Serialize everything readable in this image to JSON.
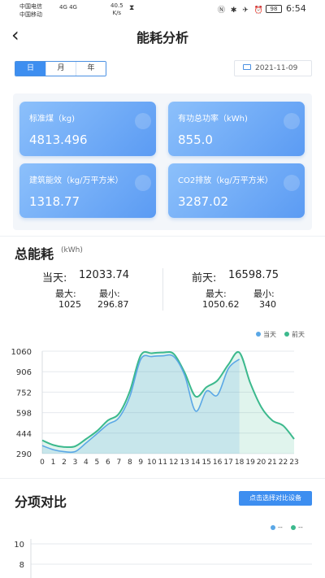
{
  "status_bar": {
    "carrier1": "中国电信",
    "carrier2": "中国移动",
    "net": "4G 4G",
    "speed_value": "40.5",
    "speed_unit": "K/s",
    "battery": "98",
    "time": "6:54"
  },
  "nav": {
    "back_icon": "chevron-left-icon",
    "title": "能耗分析"
  },
  "period_tabs": [
    {
      "label": "日",
      "active": true
    },
    {
      "label": "月",
      "active": false
    },
    {
      "label": "年",
      "active": false
    }
  ],
  "date_picker": {
    "icon": "calendar-icon",
    "value": "2021-11-09"
  },
  "cards": [
    {
      "label": "标准煤（kg)",
      "value": "4813.496"
    },
    {
      "label": "有功总功率（kWh)",
      "value": "855.0"
    },
    {
      "label": "建筑能效（kg/万平方米）",
      "value": "1318.77"
    },
    {
      "label": "CO2排放（kg/万平方米）",
      "value": "3287.02"
    }
  ],
  "total_energy": {
    "title": "总能耗",
    "unit": "(kWh)",
    "today": {
      "label": "当天:",
      "value": "12033.74",
      "max_label": "最大:",
      "min_label": "最小:",
      "max": "1025",
      "min": "296.87"
    },
    "prev": {
      "label": "前天:",
      "value": "16598.75",
      "max_label": "最大:",
      "min_label": "最小:",
      "max": "1050.62",
      "min": "340"
    }
  },
  "chart_data": {
    "type": "area",
    "title": "",
    "xlabel": "",
    "ylabel": "",
    "categories": [
      "0",
      "1",
      "2",
      "3",
      "4",
      "5",
      "6",
      "7",
      "8",
      "9",
      "10",
      "11",
      "12",
      "13",
      "14",
      "15",
      "16",
      "17",
      "18",
      "19",
      "20",
      "21",
      "22",
      "23"
    ],
    "yticks": [
      290,
      444,
      598,
      752,
      906,
      1060
    ],
    "ylim": [
      290,
      1060
    ],
    "grid": true,
    "legend_position": "top-right",
    "series": [
      {
        "name": "当天",
        "color": "#5aa7e6",
        "values": [
          350,
          320,
          305,
          305,
          370,
          440,
          510,
          560,
          720,
          1000,
          1020,
          1025,
          1020,
          880,
          610,
          760,
          730,
          930,
          1000,
          null,
          null,
          null,
          null,
          null
        ]
      },
      {
        "name": "前天",
        "color": "#3cb98d",
        "values": [
          390,
          355,
          340,
          345,
          400,
          460,
          540,
          590,
          760,
          1030,
          1045,
          1050,
          1040,
          900,
          720,
          790,
          840,
          960,
          1050,
          820,
          640,
          540,
          500,
          400
        ]
      }
    ]
  },
  "comparison": {
    "title": "分项对比",
    "button_label": "点击选择对比设备",
    "legend": [
      {
        "label": "--",
        "color": "#5aa7e6"
      },
      {
        "label": "--",
        "color": "#3cb98d"
      }
    ],
    "yticks": [
      "10",
      "8"
    ]
  }
}
